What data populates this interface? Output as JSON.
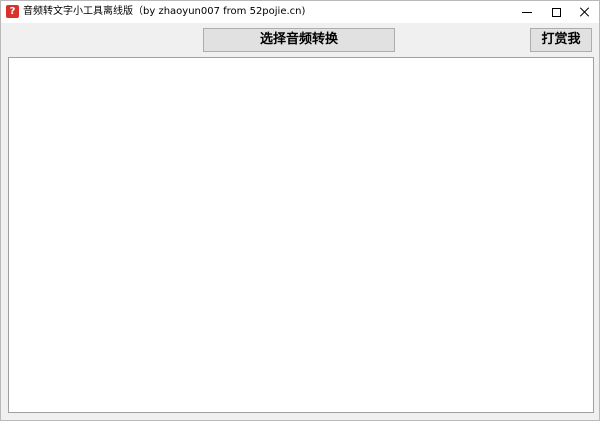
{
  "window": {
    "title": "音频转文字小工具离线版（by zhaoyun007 from 52pojie.cn)",
    "app_icon": "red-question-icon",
    "controls": {
      "minimize": "minimize-icon",
      "maximize": "maximize-icon",
      "close": "close-icon"
    }
  },
  "toolbar": {
    "convert_label": "选择音频转换",
    "donate_label": "打赏我"
  },
  "output": {
    "value": ""
  },
  "colors": {
    "app_icon_bg": "#d9312b",
    "button_bg": "#e1e1e1",
    "window_bg": "#f0f0f0"
  }
}
